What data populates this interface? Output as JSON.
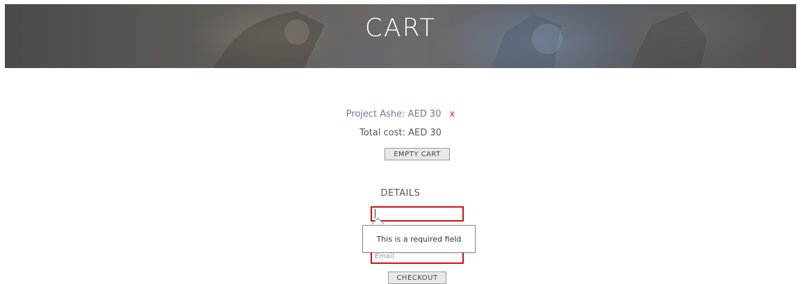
{
  "header": {
    "title": "CART"
  },
  "cart": {
    "item_text": "Project Ashe: AED 30",
    "remove_label": "x",
    "total_text": "Total cost: AED 30",
    "empty_button_label": "EMPTY CART"
  },
  "details": {
    "heading": "DETAILS",
    "name_value": "",
    "email_placeholder": "Email",
    "validation_message": "This is a required field",
    "checkout_button_label": "CHECKOUT"
  },
  "colors": {
    "item_link": "#6b7a8f",
    "remove": "#d03030",
    "invalid_border": "#cc1111"
  }
}
